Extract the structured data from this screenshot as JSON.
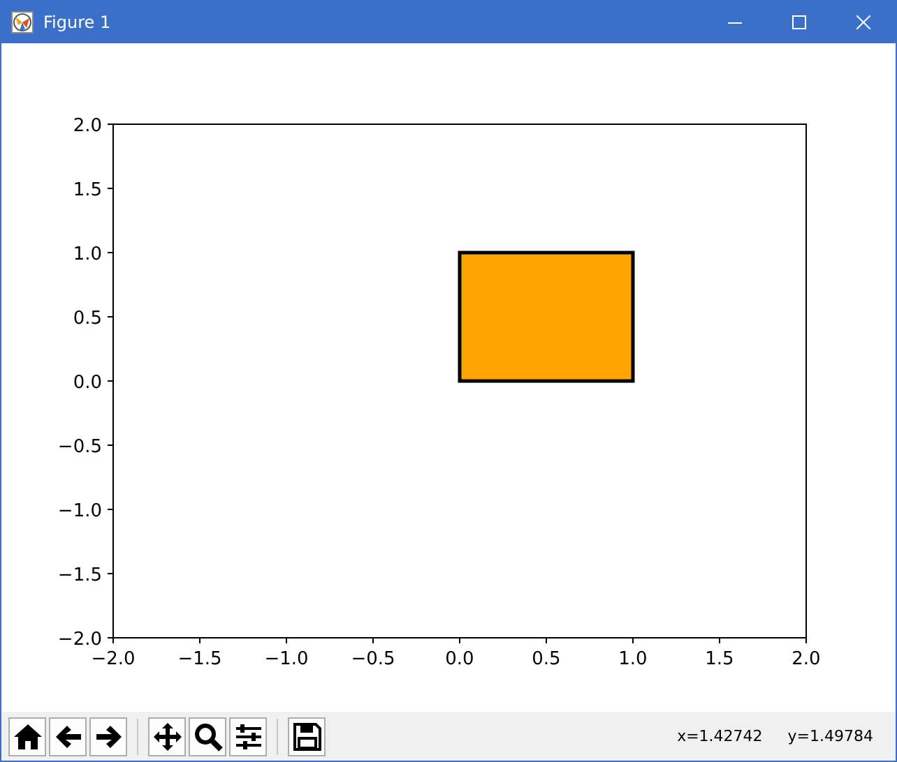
{
  "window": {
    "title": "Figure 1"
  },
  "figure": {
    "chart_data": {
      "type": "area",
      "xlim": [
        -2,
        2
      ],
      "ylim": [
        -2,
        2
      ],
      "xticks": [
        {
          "value": -2,
          "label": "−2.0"
        },
        {
          "value": -1.5,
          "label": "−1.5"
        },
        {
          "value": -1,
          "label": "−1.0"
        },
        {
          "value": -0.5,
          "label": "−0.5"
        },
        {
          "value": 0,
          "label": "0.0"
        },
        {
          "value": 0.5,
          "label": "0.5"
        },
        {
          "value": 1,
          "label": "1.0"
        },
        {
          "value": 1.5,
          "label": "1.5"
        },
        {
          "value": 2,
          "label": "2.0"
        }
      ],
      "yticks": [
        {
          "value": -2,
          "label": "−2.0"
        },
        {
          "value": -1.5,
          "label": "−1.5"
        },
        {
          "value": -1,
          "label": "−1.0"
        },
        {
          "value": -0.5,
          "label": "−0.5"
        },
        {
          "value": 0,
          "label": "0.0"
        },
        {
          "value": 0.5,
          "label": "0.5"
        },
        {
          "value": 1,
          "label": "1.0"
        },
        {
          "value": 1.5,
          "label": "1.5"
        },
        {
          "value": 2,
          "label": "2.0"
        }
      ],
      "x": [
        0,
        1
      ],
      "series": [
        {
          "color": "#ffa500",
          "values": [
            1,
            1
          ]
        }
      ]
    }
  },
  "status": {
    "x_coordinate": "x=1.42742",
    "y_coordinate": "y=1.49784"
  }
}
